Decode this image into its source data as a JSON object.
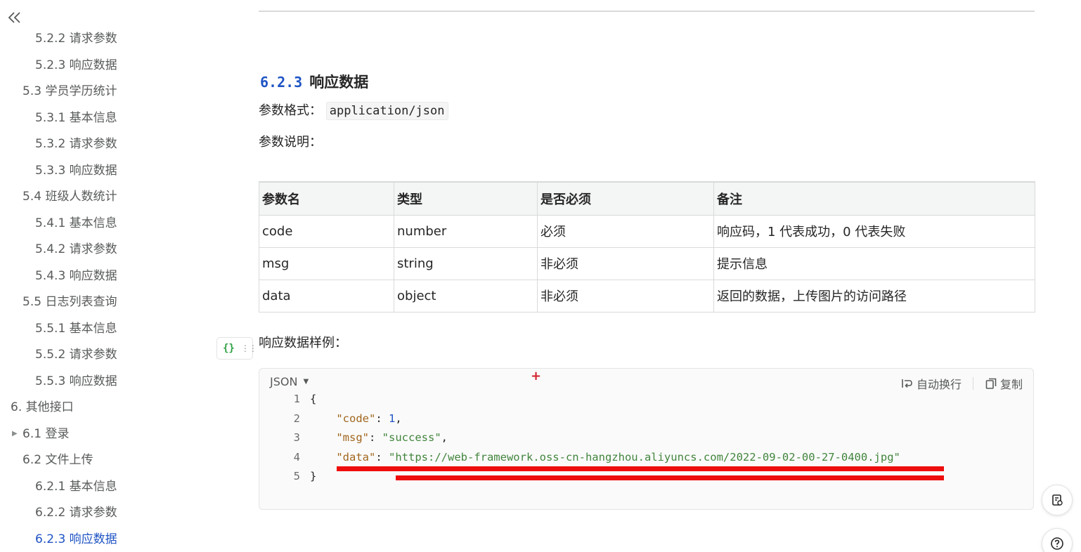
{
  "sidebar": {
    "items": [
      {
        "label": "5.2.2 请求参数",
        "level": 3
      },
      {
        "label": "5.2.3 响应数据",
        "level": 3
      },
      {
        "label": "5.3 学员学历统计",
        "level": 2
      },
      {
        "label": "5.3.1 基本信息",
        "level": 3
      },
      {
        "label": "5.3.2 请求参数",
        "level": 3
      },
      {
        "label": "5.3.3 响应数据",
        "level": 3
      },
      {
        "label": "5.4 班级人数统计",
        "level": 2
      },
      {
        "label": "5.4.1 基本信息",
        "level": 3
      },
      {
        "label": "5.4.2 请求参数",
        "level": 3
      },
      {
        "label": "5.4.3 响应数据",
        "level": 3
      },
      {
        "label": "5.5 日志列表查询",
        "level": 2
      },
      {
        "label": "5.5.1 基本信息",
        "level": 3
      },
      {
        "label": "5.5.2 请求参数",
        "level": 3
      },
      {
        "label": "5.5.3 响应数据",
        "level": 3
      },
      {
        "label": "6. 其他接口",
        "level": 1
      },
      {
        "label": "6.1 登录",
        "level": 2,
        "collapsed": true
      },
      {
        "label": "6.2 文件上传",
        "level": 2
      },
      {
        "label": "6.2.1 基本信息",
        "level": 3
      },
      {
        "label": "6.2.2 请求参数",
        "level": 3
      },
      {
        "label": "6.2.3 响应数据",
        "level": 3,
        "active": true
      }
    ],
    "active_color": "#1f54c4"
  },
  "content": {
    "heading_num": "6.2.3",
    "heading_text": "响应数据",
    "format_label": "参数格式：",
    "format_value": "application/json",
    "desc_label": "参数说明：",
    "table": {
      "headers": [
        "参数名",
        "类型",
        "是否必须",
        "备注"
      ],
      "rows": [
        [
          "code",
          "number",
          "必须",
          "响应码，1 代表成功，0 代表失败"
        ],
        [
          "msg",
          "string",
          "非必须",
          "提示信息"
        ],
        [
          "data",
          "object",
          "非必须",
          "返回的数据，上传图片的访问路径"
        ]
      ]
    },
    "example_label": "响应数据样例：",
    "code_block": {
      "language": "JSON",
      "wrap_label": "自动换行",
      "copy_label": "复制",
      "lines": [
        {
          "num": "1",
          "indent": "",
          "tokens": [
            {
              "t": "{",
              "c": "p"
            }
          ]
        },
        {
          "num": "2",
          "indent": "    ",
          "tokens": [
            {
              "t": "\"code\"",
              "c": "key"
            },
            {
              "t": ": ",
              "c": "p"
            },
            {
              "t": "1",
              "c": "num"
            },
            {
              "t": ",",
              "c": "p"
            }
          ]
        },
        {
          "num": "3",
          "indent": "    ",
          "tokens": [
            {
              "t": "\"msg\"",
              "c": "key"
            },
            {
              "t": ": ",
              "c": "p"
            },
            {
              "t": "\"success\"",
              "c": "str"
            },
            {
              "t": ",",
              "c": "p"
            }
          ]
        },
        {
          "num": "4",
          "indent": "    ",
          "tokens": [
            {
              "t": "\"data\"",
              "c": "key"
            },
            {
              "t": ": ",
              "c": "p"
            },
            {
              "t": "\"https://web-framework.oss-cn-hangzhou.aliyuncs.com/2022-09-02-00-27-0400.jpg\"",
              "c": "str"
            }
          ]
        },
        {
          "num": "5",
          "indent": "",
          "tokens": [
            {
              "t": "}",
              "c": "p"
            }
          ]
        }
      ]
    }
  },
  "colors": {
    "link_blue": "#1f54c4",
    "annotation_red": "#ee0d0d",
    "json_key": "#a1661e",
    "json_string": "#42853d"
  }
}
